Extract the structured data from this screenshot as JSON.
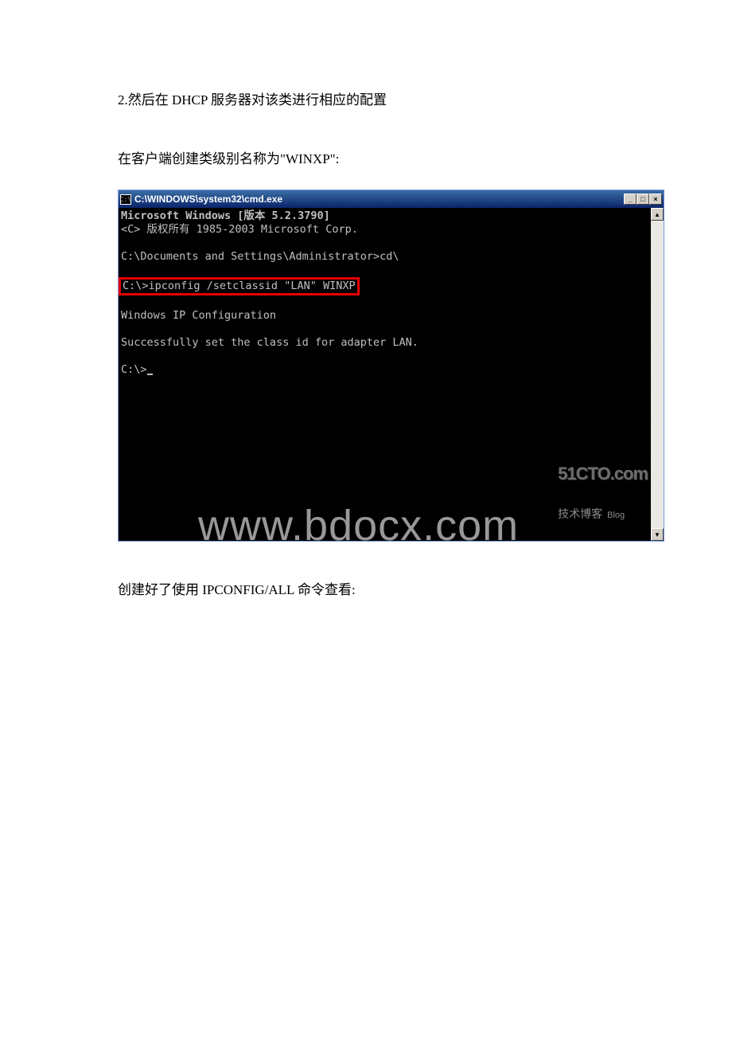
{
  "doc": {
    "line1": "2.然后在 DHCP 服务器对该类进行相应的配置",
    "line2": "在客户端创建类级别名称为\"WINXP\":",
    "line3": "创建好了使用 IPCONFIG/ALL 命令查看:"
  },
  "cmd": {
    "icon_label": "C:\\",
    "title": "C:\\WINDOWS\\system32\\cmd.exe",
    "content": {
      "l1": "Microsoft Windows [版本 5.2.3790]",
      "l2": "<C> 版权所有 1985-2003 Microsoft Corp.",
      "l3": "C:\\Documents and Settings\\Administrator>cd\\",
      "l4": "C:\\>ipconfig /setclassid \"LAN\" WINXP",
      "l5": "Windows IP Configuration",
      "l6": "Successfully set the class id for adapter LAN.",
      "l7": "C:\\>"
    }
  },
  "watermark": {
    "main": "www.bdocx.com",
    "cto": "51CTO.com",
    "sub1": "技术博客",
    "sub2": "Blog"
  },
  "winbtn": {
    "min": "_",
    "max": "□",
    "close": "×"
  },
  "scroll": {
    "up": "▲",
    "down": "▼"
  }
}
